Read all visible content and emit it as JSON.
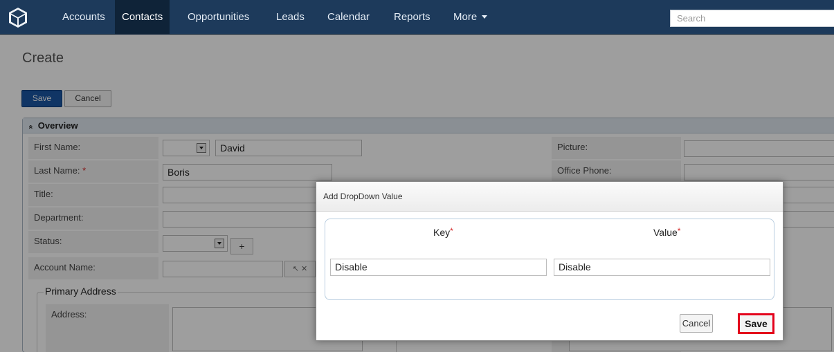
{
  "nav": {
    "logo_icon": "cube-icon",
    "items": [
      {
        "label": "Accounts"
      },
      {
        "label": "Contacts"
      },
      {
        "label": "Opportunities"
      },
      {
        "label": "Leads"
      },
      {
        "label": "Calendar"
      },
      {
        "label": "Reports"
      },
      {
        "label": "More"
      }
    ],
    "search_placeholder": "Search"
  },
  "page": {
    "title": "Create",
    "save_label": "Save",
    "cancel_label": "Cancel"
  },
  "panel": {
    "header": "Overview",
    "header_icon": "double-chevron-up-icon",
    "fields": {
      "first_name_label": "First Name:",
      "first_name_value": "David",
      "last_name_label": "Last Name:",
      "last_name_required": "*",
      "last_name_value": "Boris",
      "title_label": "Title:",
      "department_label": "Department:",
      "status_label": "Status:",
      "status_add_label": "+",
      "account_name_label": "Account Name:",
      "picture_label": "Picture:",
      "office_phone_label": "Office Phone:"
    },
    "primary_address": {
      "legend": "Primary Address",
      "address_label": "Address:"
    }
  },
  "modal": {
    "title": "Add DropDown Value",
    "key_header": "Key",
    "value_header": "Value",
    "required_marker": "*",
    "key_value": "Disable",
    "value_value": "Disable",
    "cancel_label": "Cancel",
    "save_label": "Save",
    "highlight_color": "#e3001b"
  },
  "colors": {
    "nav_background": "#1d3a5b",
    "primary_button": "#1a56a3"
  }
}
